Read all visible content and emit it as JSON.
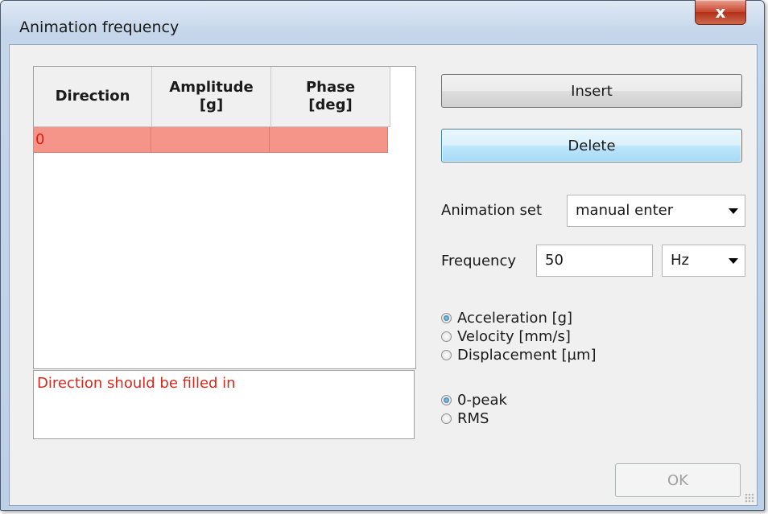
{
  "window": {
    "title": "Animation frequency",
    "close_symbol": "x"
  },
  "table": {
    "columns": [
      "Direction",
      "Amplitude\n[g]",
      "Phase\n[deg]"
    ],
    "rows": [
      {
        "direction": "0",
        "amplitude": "",
        "phase": ""
      }
    ]
  },
  "message": "Direction should be filled in",
  "buttons": {
    "insert": "Insert",
    "delete": "Delete",
    "ok": "OK"
  },
  "animation_set": {
    "label": "Animation set",
    "value": "manual enter"
  },
  "frequency": {
    "label": "Frequency",
    "value": "50",
    "unit": "Hz"
  },
  "quantity_options": [
    {
      "label": "Acceleration [g]",
      "checked": true
    },
    {
      "label": "Velocity [mm/s]",
      "checked": false
    },
    {
      "label": "Displacement [µm]",
      "checked": false
    }
  ],
  "scale_options": [
    {
      "label": "0-peak",
      "checked": true
    },
    {
      "label": "RMS",
      "checked": false
    }
  ],
  "colors": {
    "selected_row": "#f5958a",
    "error_text": "#d6291b"
  }
}
